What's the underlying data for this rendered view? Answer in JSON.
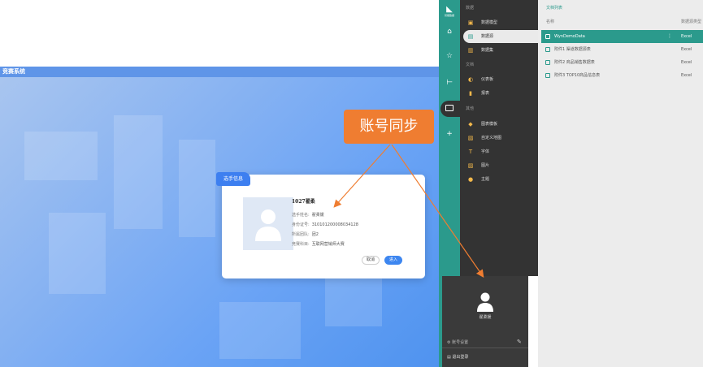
{
  "left_page": {
    "header_title": "竞赛系统",
    "card": {
      "tag": "选手信息",
      "name": "1027翟柔",
      "rows": [
        {
          "label": "选手姓名:",
          "value": "翟柔媛"
        },
        {
          "label": "身份证号:",
          "value": "310101200008034128"
        },
        {
          "label": "所属团队:",
          "value": "团2"
        },
        {
          "label": "竞赛科目:",
          "value": "互联网营销师大赛"
        }
      ],
      "cancel_label": "取消",
      "enter_label": "进入"
    }
  },
  "callout": {
    "text": "账号同步",
    "color": "#ef7d31"
  },
  "nav": {
    "icons": [
      "logo-icon",
      "home-icon",
      "star-icon",
      "tree-icon",
      "folder-icon",
      "plus-icon"
    ],
    "accent": "#2b9a8c",
    "logo_text": "智能数据"
  },
  "menu": {
    "sections": [
      "数据",
      "文档",
      "其他"
    ],
    "items": [
      {
        "icon": "▣",
        "label": "数据模型"
      },
      {
        "icon": "▤",
        "label": "数据源"
      },
      {
        "icon": "▥",
        "label": "数据集"
      },
      {
        "icon": "◐",
        "label": "仪表板"
      },
      {
        "icon": "▮",
        "label": "报表"
      },
      {
        "icon": "◆",
        "label": "图表模板"
      },
      {
        "icon": "▧",
        "label": "自定义地图"
      },
      {
        "icon": "T",
        "label": "字体"
      },
      {
        "icon": "▨",
        "label": "图片"
      },
      {
        "icon": "●",
        "label": "主题"
      }
    ]
  },
  "user_popup": {
    "username": "翟柔媛",
    "account_label": "账号设置",
    "logout_label": "退出登录"
  },
  "file_panel": {
    "title": "文档列表",
    "col_name": "名称",
    "col_type": "数据源类型",
    "rows": [
      {
        "name": "WynDemoData",
        "type": "Excel"
      },
      {
        "name": "附件1 渠道数据源表",
        "type": "Excel"
      },
      {
        "name": "附件2 商品销售数据表",
        "type": "Excel"
      },
      {
        "name": "附件3 TOP10商品信息表",
        "type": "Excel"
      }
    ]
  }
}
